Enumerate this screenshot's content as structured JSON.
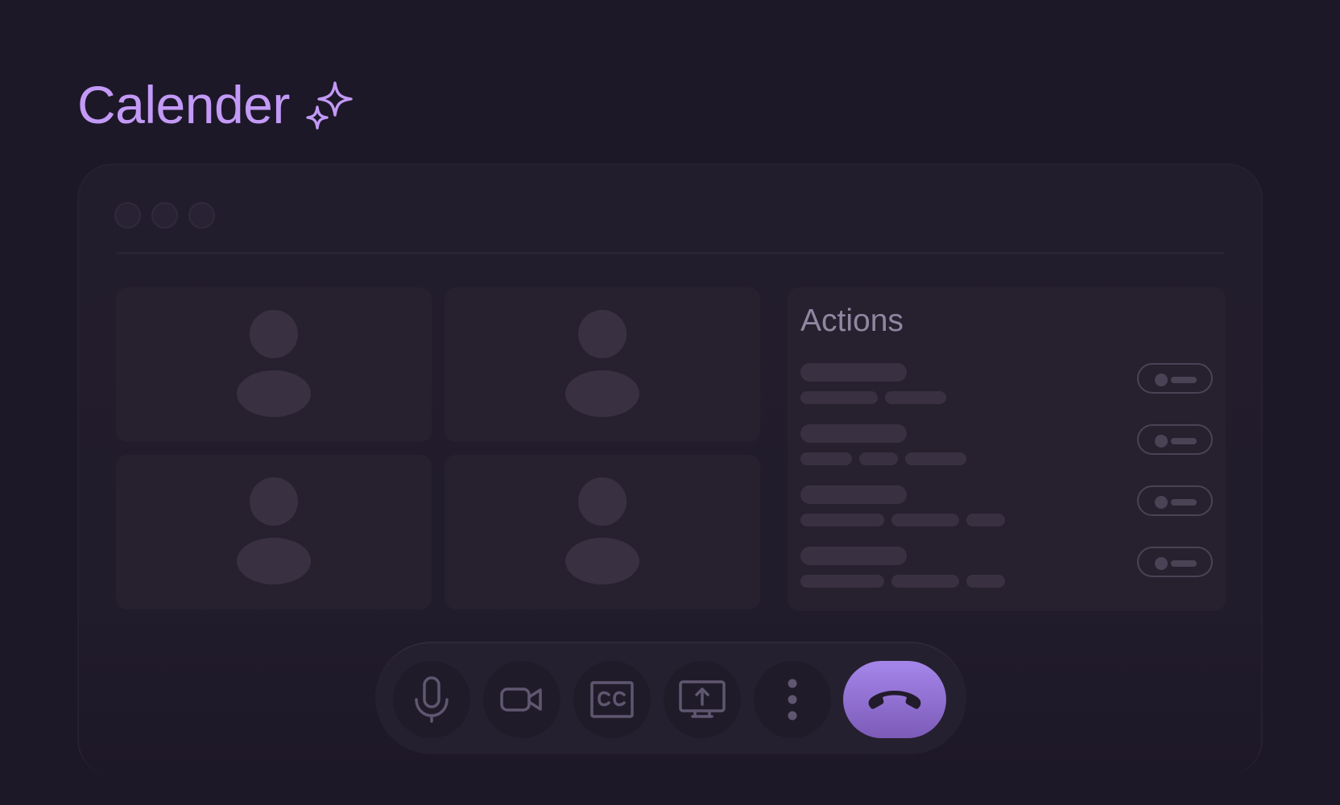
{
  "page": {
    "title": "Calender"
  },
  "icons": {
    "title_decoration": "sparkle-icon",
    "mic": "microphone-icon",
    "camera": "video-camera-icon",
    "captions": "closed-captions-icon",
    "share": "screen-share-icon",
    "more": "more-vertical-icon",
    "hangup": "hang-up-icon"
  },
  "panel": {
    "title": "Actions"
  },
  "colors": {
    "accent": "#c39af7",
    "end_call": "#9b7ae0",
    "background": "#1d1828"
  }
}
